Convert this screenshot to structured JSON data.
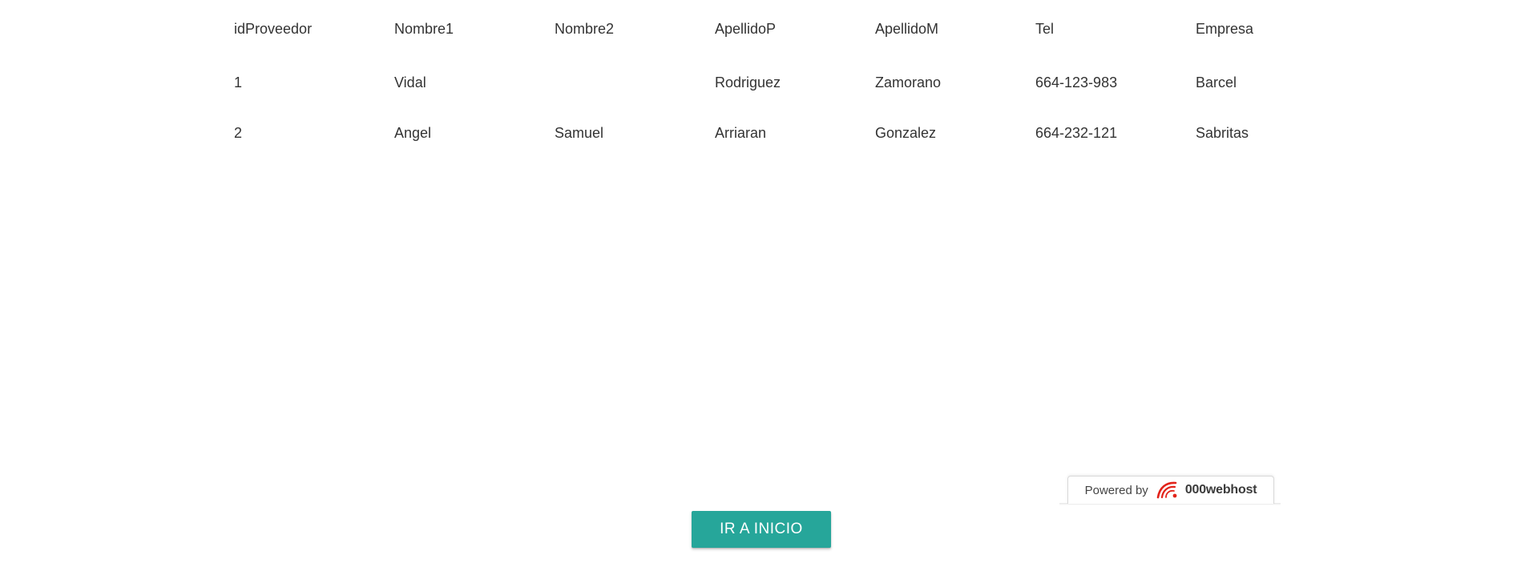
{
  "table": {
    "columns": [
      "idProveedor",
      "Nombre1",
      "Nombre2",
      "ApellidoP",
      "ApellidoM",
      "Tel",
      "Empresa"
    ],
    "rows": [
      [
        "1",
        "Vidal",
        "",
        "Rodriguez",
        "Zamorano",
        "664-123-983",
        "Barcel"
      ],
      [
        "2",
        "Angel",
        "Samuel",
        "Arriaran",
        "Gonzalez",
        "664-232-121",
        "Sabritas"
      ]
    ]
  },
  "button": {
    "label": "IR A INICIO",
    "color": "#26a69a"
  },
  "footer_badge": {
    "powered_label": "Powered by",
    "brand": "000webhost",
    "brand_icon": "000webhost-logo-icon",
    "brand_color": "#e2231a"
  }
}
